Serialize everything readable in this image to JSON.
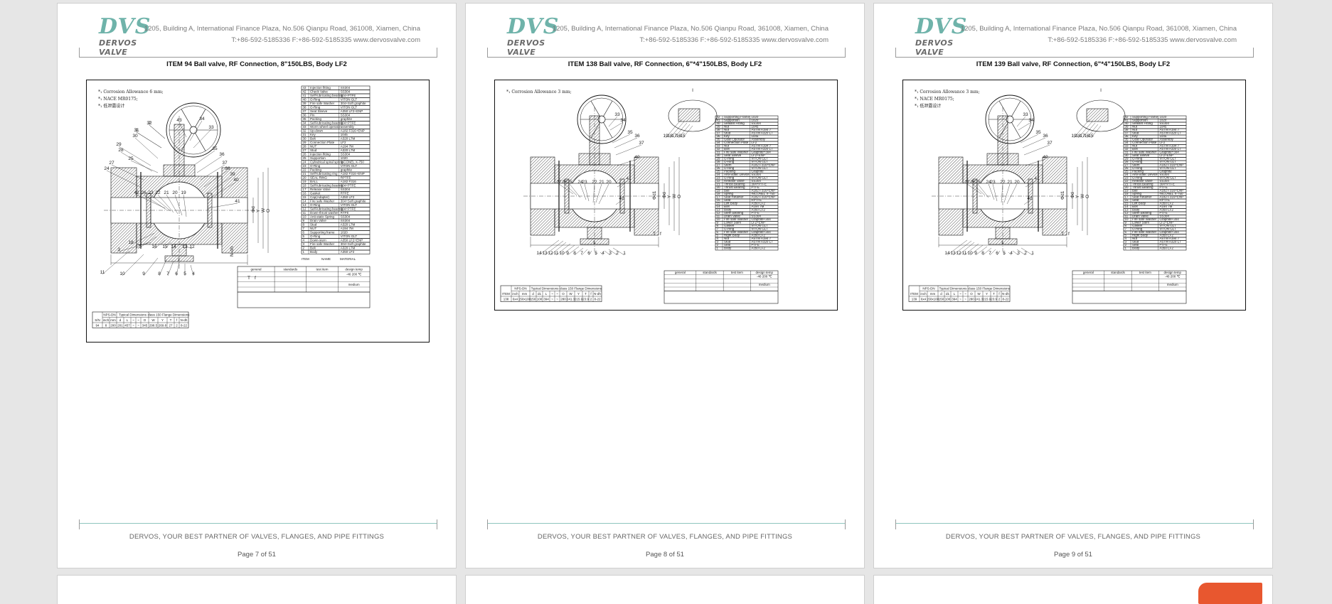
{
  "header": {
    "logo_mark": "DVS",
    "logo_brand": "DERVOS VALVE",
    "address_line": "1205, Building A, International Finance Plaza, No.506 Qianpu Road, 361008, Xiamen, China",
    "contact_line": "T:+86-592-5185336   F:+86-592-5185335   www.dervosvalve.com"
  },
  "footer": {
    "tagline": "DERVOS, YOUR BEST PARTNER OF VALVES, FLANGES, AND PIPE FITTINGS"
  },
  "pages": [
    {
      "item_title": "ITEM 94 Ball valve, RF Connection, 8\"150LBS, Body LF2",
      "page_label": "Page 7 of 51",
      "notes": [
        "Corrosion Allowance 6 mm;",
        "NACE MR0175;",
        "低泄露设计"
      ]
    },
    {
      "item_title": "ITEM 138      Ball valve, RF Connection, 6\"*4\"150LBS, Body LF2",
      "page_label": "Page 8 of 51",
      "notes": [
        "Corrosion Allowance 3 mm;"
      ]
    },
    {
      "item_title": "ITEM 139      Ball valve, RF Connection, 6\"*4\"150LBS, Body LF2",
      "page_label": "Page 9 of 51",
      "notes": [
        "Corrosion Allowance 3 mm;",
        "NACE MR0175;",
        "低泄露设计"
      ]
    }
  ],
  "tables": {
    "item94": {
      "group_headers": [
        "NPS-DN",
        "Typical Dimensions",
        "class 150 Flange Dimensions"
      ],
      "col_headers": [
        "S/N",
        "inch",
        "mm",
        "d",
        "L",
        "~",
        "~",
        "O",
        "W",
        "Y",
        "T",
        "f",
        "N-dh"
      ],
      "row": [
        "94",
        "8",
        "200",
        "201",
        "457",
        "~",
        "~",
        "345",
        "298.5",
        "269.8",
        "27",
        "2",
        "8-22"
      ]
    },
    "item138": {
      "group_headers": [
        "NPS-DN",
        "Typical Dimensions",
        "class 150 Flange Dimensions"
      ],
      "col_headers": [
        "ITEM",
        "inch",
        "mm",
        "d",
        "d1",
        "L",
        "~",
        "~",
        "O",
        "W",
        "Y",
        "T",
        "f",
        "N-dh"
      ],
      "row": [
        "138",
        "6x4",
        "150x100",
        "150",
        "100",
        "394",
        "~",
        "~",
        "280",
        "241.3",
        "215.9",
        "23.9",
        "2",
        "8-22"
      ]
    },
    "item139": {
      "group_headers": [
        "NPS-DN",
        "Typical Dimensions",
        "class 150 Flange Dimensions"
      ],
      "col_headers": [
        "ITEM",
        "inch",
        "mm",
        "d",
        "d1",
        "L",
        "~",
        "~",
        "O",
        "W",
        "Y",
        "T",
        "f",
        "N-dh"
      ],
      "row": [
        "139",
        "6x4",
        "150x100",
        "150",
        "100",
        "394",
        "~",
        "~",
        "280",
        "241.3",
        "215.9",
        "23.9",
        "2",
        "8-22"
      ]
    }
  },
  "dimension_labels": {
    "length": "L",
    "bore": "Φd",
    "bore1": "Φd1",
    "y": "Y",
    "w": "W",
    "o": "O",
    "t": "T",
    "f": "f",
    "ndh": "N-dh"
  },
  "title_block": {
    "general": "general",
    "standards": "standards",
    "test_item": "test item",
    "design_temp": "design temp",
    "temp_range": "-46 200 ℃",
    "medium": "medium"
  },
  "bom_headers": {
    "item": "ITEM",
    "name": "NAME",
    "material": "MATERIAL"
  },
  "bom_94": [
    [
      "43",
      "Injection fitting",
      "SS304"
    ],
    [
      "42",
      "Check Valve",
      "SS304"
    ],
    [
      "41",
      "Self-lubricating bearing",
      "304+PTFE"
    ],
    [
      "40",
      "O-Ring",
      "VITON GLT"
    ],
    [
      "39",
      "Fire safe Washer",
      "304+Soft graphite"
    ],
    [
      "38",
      "O-Ring",
      "VITON GLT"
    ],
    [
      "37",
      "Seat Sleeve",
      "A350 LF2+ENP"
    ],
    [
      "36",
      "Pin",
      "SS304"
    ],
    [
      "35",
      "Packing",
      "graphite"
    ],
    [
      "34",
      "Self-lubricating bearing",
      "304+PTFE"
    ],
    [
      "33",
      "Worm wheel operator",
      "assembly"
    ],
    [
      "32",
      "Up-down",
      "A182 F316+ENP"
    ],
    [
      "31",
      "Key",
      "1045"
    ],
    [
      "30",
      "Bolt",
      "A320 L7M"
    ],
    [
      "29",
      "Connection Plate",
      "LF2"
    ],
    [
      "28",
      "NUT",
      "A194 7M"
    ],
    [
      "27",
      "Stud",
      "A320 L7M"
    ],
    [
      "26",
      "Injection fitting",
      "SS304"
    ],
    [
      "25",
      "Supportion",
      "1020"
    ],
    [
      "24",
      "Cylindrical spiral spring",
      "INCONEL X-750"
    ],
    [
      "23",
      "O-Ring",
      "VITON GLT"
    ],
    [
      "22",
      "Packing",
      "graphite"
    ],
    [
      "21",
      "Self-lubricating ring",
      "A182 F316+ENP"
    ],
    [
      "20",
      "SEAL RING",
      "RPTFE"
    ],
    [
      "19",
      "BALL",
      "A182 F316"
    ],
    [
      "18",
      "Self-lubricating bearing",
      "304+PTFE"
    ],
    [
      "17",
      "Release Valve",
      "SS304"
    ],
    [
      "16",
      "Gasket",
      "RTFE"
    ],
    [
      "15",
      "Cap(Adapter)",
      "A350 LF2"
    ],
    [
      "14",
      "Fire safe Washer",
      "304+Soft graphite"
    ],
    [
      "13",
      "O-Ring",
      "VITON GLT"
    ],
    [
      "12",
      "Self-lubricating bearing",
      "304+PTFE"
    ],
    [
      "11",
      "Down-thrust washer",
      "RTFE"
    ],
    [
      "10",
      "Anti-static Spring",
      "SS304"
    ],
    [
      "9",
      "Drain Valve",
      "SS304"
    ],
    [
      "8",
      "Stud",
      "A320 L7M"
    ],
    [
      "7",
      "NUT",
      "A194 7M"
    ],
    [
      "6",
      "Supporting frame",
      "1020"
    ],
    [
      "5",
      "O-Ring",
      "VITON GLT"
    ],
    [
      "4",
      "Down-stem",
      "A350 LF2+ENP"
    ],
    [
      "3",
      "Fire safe Washer",
      "304+Soft graphite"
    ],
    [
      "2",
      "Bolt",
      "A320 L7M"
    ],
    [
      "1",
      "Body",
      "A350 LF2"
    ]
  ],
  "bom_138": [
    [
      "42",
      "Supporting Frame",
      "1020"
    ],
    [
      "41",
      "Supportion",
      "1020"
    ],
    [
      "40",
      "Sealant Fitting",
      "SS304"
    ],
    [
      "39",
      "Nut",
      "1045"
    ],
    [
      "38",
      "Nut",
      "ASTM A194 7"
    ],
    [
      "37",
      "Stud",
      "ASTM A320 L7"
    ],
    [
      "36",
      "Key",
      "1045"
    ],
    [
      "35",
      "Gear Operator",
      "Assembly"
    ],
    [
      "34",
      "Connection Plate",
      "LF2"
    ],
    [
      "33",
      "Nut",
      "ASTM A194 7"
    ],
    [
      "32",
      "Bolt",
      "ASTM A320 L7"
    ],
    [
      "31",
      "Fire safe Washer",
      "Graphite+304"
    ],
    [
      "30",
      "Seat Sleeve",
      "LF2+ENP"
    ],
    [
      "29",
      "O-Ring",
      "VITON GLT"
    ],
    [
      "28",
      "O-Ring",
      "VITON GLT"
    ],
    [
      "27",
      "Stem",
      "A182 F316+ENP"
    ],
    [
      "26",
      "O-Ring",
      "VITON GLT"
    ],
    [
      "25",
      "Packing",
      "Graphite"
    ],
    [
      "24",
      "Anti-Static Device",
      "SS304"
    ],
    [
      "23",
      "O-Ring",
      "VITON GLT"
    ],
    [
      "22",
      "Release Valve",
      "SS304"
    ],
    [
      "21",
      "Thrust Bearing",
      "304+PTFE"
    ],
    [
      "20",
      "Thrust Bearing",
      "PTFE"
    ],
    [
      "19",
      "Ball",
      "A182 F316+ENP"
    ],
    [
      "18",
      "Spring",
      "INCONEL X-750"
    ],
    [
      "17",
      "Seat Retainer",
      "A182 F316+ENP"
    ],
    [
      "16",
      "Seat",
      "RPTFE"
    ],
    [
      "15",
      "Left Body",
      "A350 LF2"
    ],
    [
      "14",
      "Bolt",
      "A194 7M"
    ],
    [
      "13",
      "Body",
      "A350 LF2"
    ],
    [
      "12",
      "Stem Bearing",
      "PTFE"
    ],
    [
      "11",
      "Drain Valve",
      "SS304"
    ],
    [
      "10",
      "Fire safe Washer",
      "Graphite+304"
    ],
    [
      "9",
      "Lower Stem",
      "LF2+ENP"
    ],
    [
      "8",
      "Gasket",
      "VITON GLT"
    ],
    [
      "7",
      "O-Ring",
      "VITON GLT"
    ],
    [
      "6",
      "Fire safe Washer",
      "Graphite+304"
    ],
    [
      "5",
      "Right Body",
      "A350 LF2"
    ],
    [
      "4",
      "Nut",
      "ASTM A194 7"
    ],
    [
      "3",
      "Stud",
      "ASTM A320 L7"
    ],
    [
      "2",
      "Seal",
      "PTFE"
    ],
    [
      "1",
      "Body",
      "A350 LF2"
    ]
  ],
  "balloons_94": [
    "32",
    "31",
    "30",
    "29",
    "28",
    "27",
    "24",
    "25",
    "43",
    "34",
    "33",
    "35",
    "36",
    "37",
    "38",
    "39",
    "40",
    "41",
    "42",
    "26",
    "23",
    "22",
    "21",
    "20",
    "19",
    "18",
    "17",
    "16",
    "15",
    "14",
    "13",
    "12",
    "11",
    "10",
    "9",
    "8",
    "7",
    "6",
    "5",
    "4",
    "3",
    "2",
    "1"
  ],
  "balloons_138": [
    "33",
    "34",
    "35",
    "36",
    "37",
    "40",
    "41",
    "27",
    "26",
    "25",
    "24",
    "23",
    "22",
    "21",
    "20",
    "19",
    "18",
    "17",
    "16",
    "15",
    "14",
    "13",
    "12",
    "11",
    "10",
    "9",
    "8",
    "7",
    "6",
    "5",
    "4",
    "3",
    "2",
    "1",
    "42"
  ],
  "colors": {
    "background": "#e6e6e6",
    "page": "#ffffff",
    "logo_teal": "#6fb3aa",
    "footer_line": "#8ec5be",
    "drawing_line": "#111111"
  }
}
